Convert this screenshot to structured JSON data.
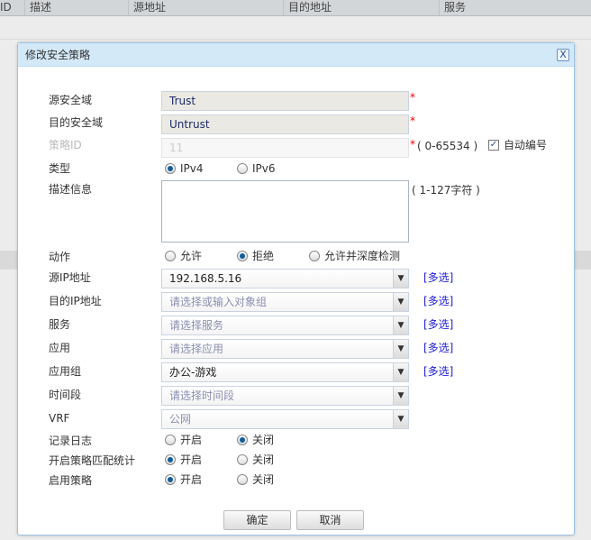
{
  "background_table": {
    "columns": [
      "ID",
      "描述",
      "源地址",
      "目的地址",
      "服务"
    ]
  },
  "dialog": {
    "title": "修改安全策略",
    "close_label": "X",
    "fields": {
      "src_zone": {
        "label": "源安全域",
        "value": "Trust",
        "required": "*"
      },
      "dst_zone": {
        "label": "目的安全域",
        "value": "Untrust",
        "required": "*"
      },
      "policy_id": {
        "label": "策略ID",
        "value": "11",
        "required": "*",
        "range": "( 0-65534 )",
        "auto_label": "自动编号",
        "auto_checked": true,
        "check_mark": "✓"
      },
      "type": {
        "label": "类型",
        "options": [
          "IPv4",
          "IPv6"
        ],
        "selected": "IPv4"
      },
      "desc": {
        "label": "描述信息",
        "value": "",
        "hint": "( 1-127字符 )"
      },
      "action": {
        "label": "动作",
        "options": [
          "允许",
          "拒绝",
          "允许并深度检测"
        ],
        "selected": "拒绝"
      },
      "src_ip": {
        "label": "源IP地址",
        "value": "192.168.5.16",
        "multi": "[多选]"
      },
      "dst_ip": {
        "label": "目的IP地址",
        "placeholder": "请选择或输入对象组",
        "multi": "[多选]"
      },
      "service": {
        "label": "服务",
        "placeholder": "请选择服务",
        "multi": "[多选]"
      },
      "app": {
        "label": "应用",
        "placeholder": "请选择应用",
        "multi": "[多选]"
      },
      "app_group": {
        "label": "应用组",
        "value": "办公-游戏",
        "multi": "[多选]"
      },
      "time_range": {
        "label": "时间段",
        "placeholder": "请选择时间段"
      },
      "vrf": {
        "label": "VRF",
        "placeholder": "公网"
      },
      "log": {
        "label": "记录日志",
        "on": "开启",
        "off": "关闭",
        "selected": "关闭"
      },
      "match_stats": {
        "label": "开启策略匹配统计",
        "on": "开启",
        "off": "关闭",
        "selected": "开启"
      },
      "enable": {
        "label": "启用策略",
        "on": "开启",
        "off": "关闭",
        "selected": "开启"
      }
    },
    "ok_label": "确定",
    "cancel_label": "取消",
    "arrow": "▼"
  }
}
